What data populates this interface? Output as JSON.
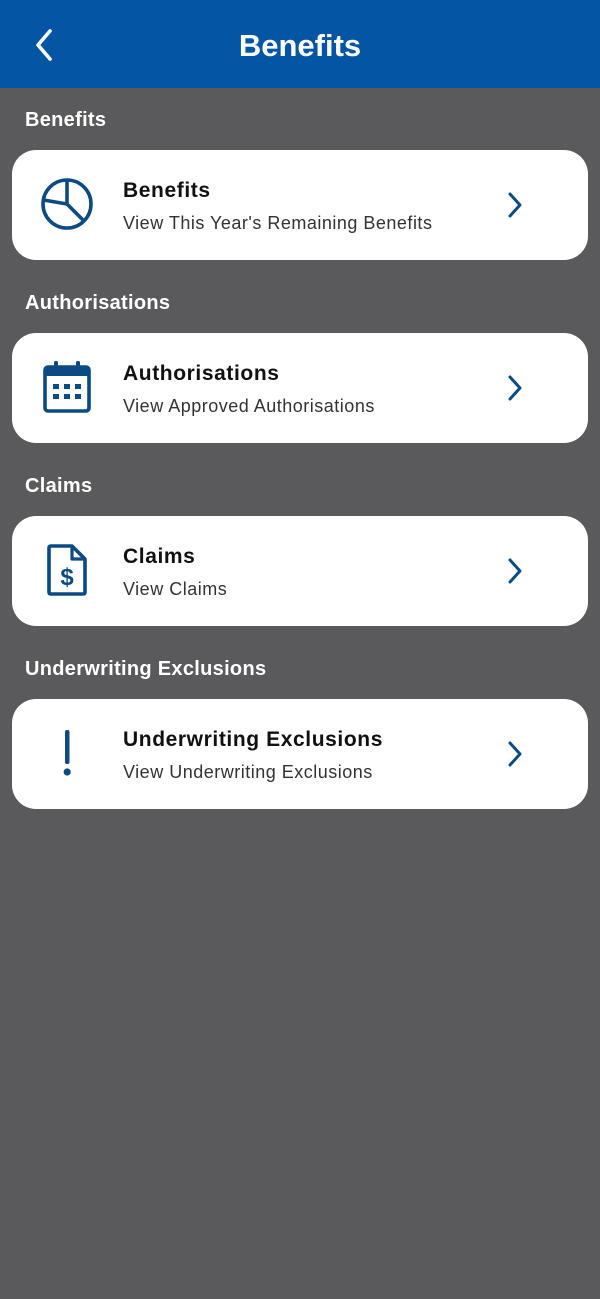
{
  "header": {
    "title": "Benefits",
    "back_icon": "chevron-left-icon",
    "background": "#0455a3"
  },
  "accent_color": "#0b4a82",
  "sections": [
    {
      "heading": "Benefits",
      "card": {
        "title": "Benefits",
        "subtitle": "View This Year's Remaining Benefits",
        "icon": "pie-chart-icon"
      }
    },
    {
      "heading": "Authorisations",
      "card": {
        "title": "Authorisations",
        "subtitle": "View Approved Authorisations",
        "icon": "calendar-icon"
      }
    },
    {
      "heading": "Claims",
      "card": {
        "title": "Claims",
        "subtitle": "View Claims",
        "icon": "dollar-document-icon"
      }
    },
    {
      "heading": "Underwriting Exclusions",
      "card": {
        "title": "Underwriting Exclusions",
        "subtitle": "View Underwriting Exclusions",
        "icon": "exclamation-icon"
      }
    }
  ]
}
